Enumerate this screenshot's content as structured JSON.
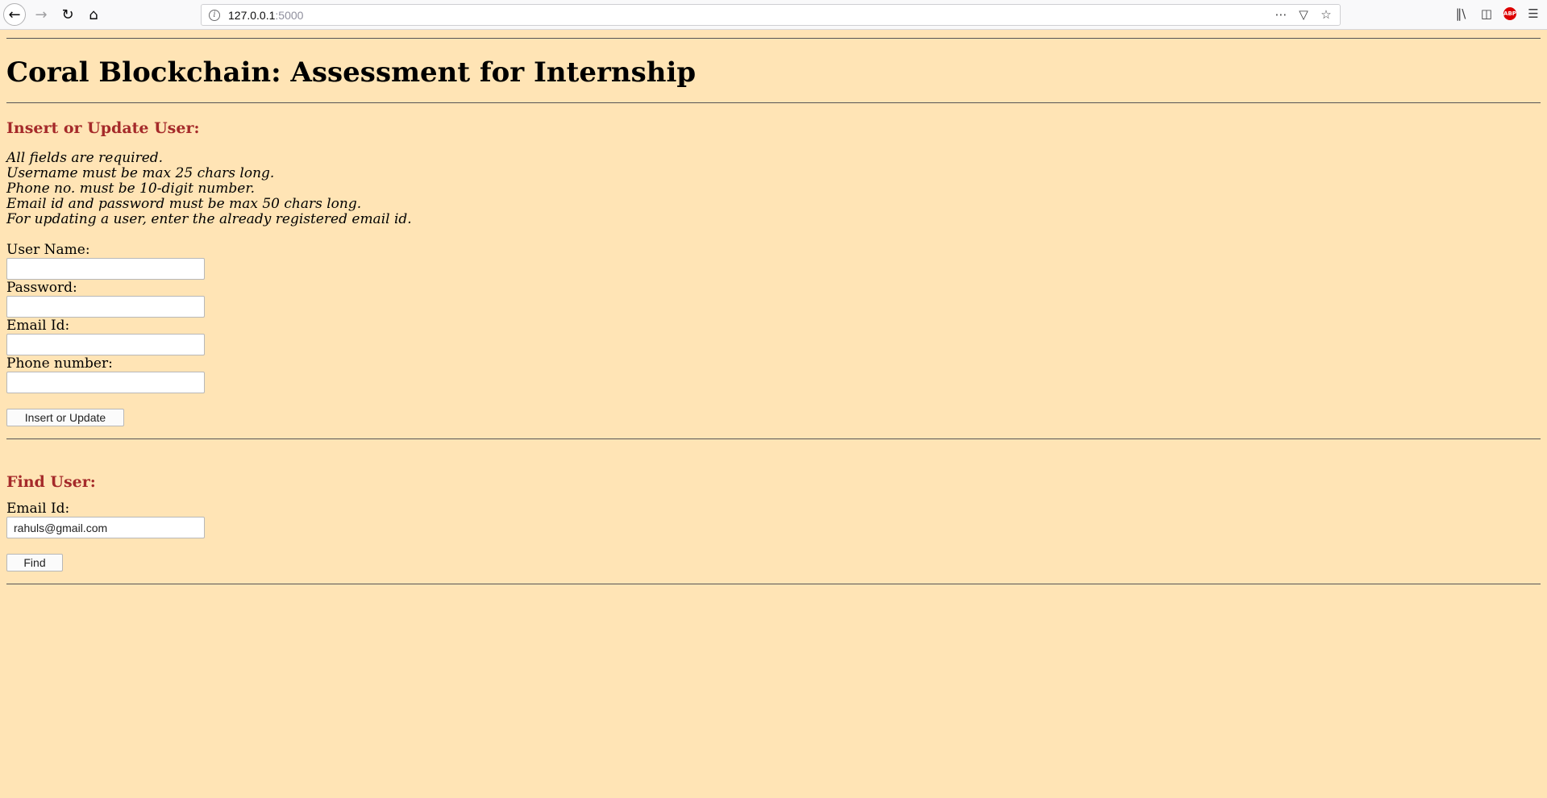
{
  "browser": {
    "url_host": "127.0.0.1",
    "url_port": ":5000",
    "icons": {
      "back": "back-arrow-icon",
      "forward": "forward-arrow-icon",
      "reload": "reload-icon",
      "home": "home-icon",
      "info": "site-info-icon",
      "more": "more-icon",
      "pocket": "pocket-icon",
      "bookmark": "star-icon",
      "library": "library-icon",
      "sidebar": "sidebar-icon",
      "abp": "adblock-icon",
      "menu": "hamburger-menu-icon"
    },
    "abp_label": "ABP"
  },
  "page": {
    "background": "#ffe4b5",
    "heading_color": "#a52a2a",
    "title": "Coral Blockchain: Assessment for Internship",
    "insert_section": {
      "heading": "Insert or Update User:",
      "notes": [
        "All fields are required.",
        "Username must be max 25 chars long.",
        "Phone no. must be 10-digit number.",
        "Email id and password must be max 50 chars long.",
        "For updating a user, enter the already registered email id."
      ],
      "username_label": "User Name:",
      "username_value": "",
      "password_label": "Password:",
      "password_value": "",
      "email_label": "Email Id:",
      "email_value": "",
      "phone_label": "Phone number:",
      "phone_value": "",
      "submit_label": "Insert or Update"
    },
    "find_section": {
      "heading": "Find User:",
      "email_label": "Email Id:",
      "email_value": "rahuls@gmail.com",
      "submit_label": "Find"
    }
  }
}
